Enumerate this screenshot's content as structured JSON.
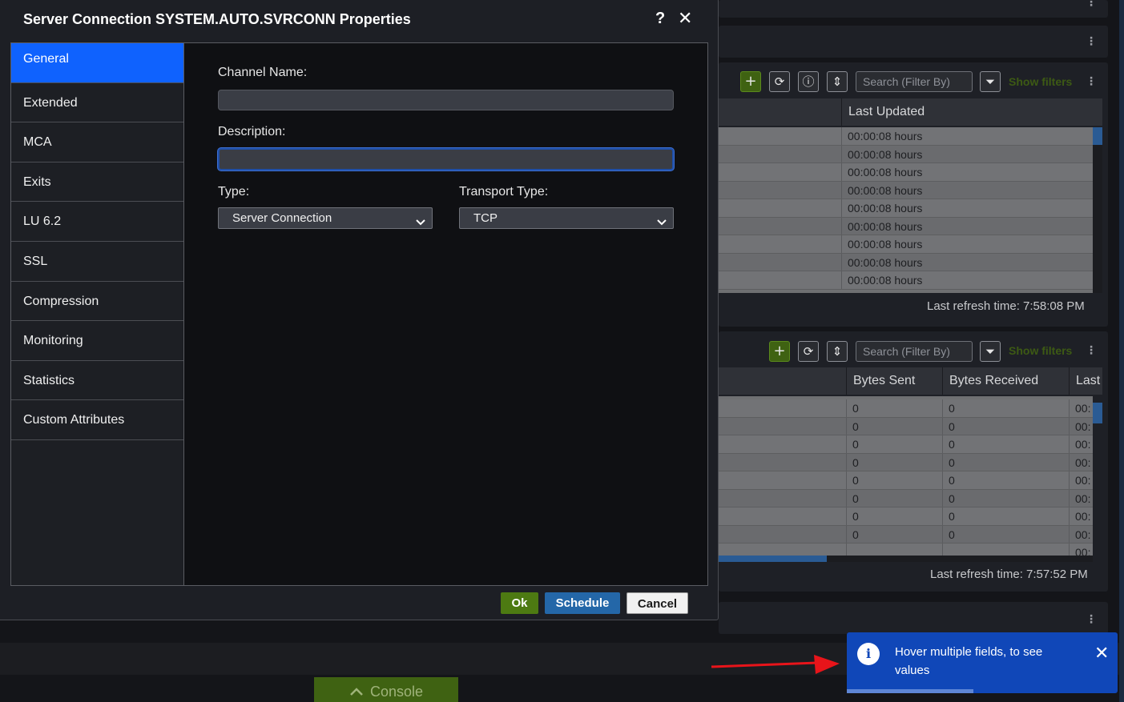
{
  "dialog": {
    "title": "Server Connection SYSTEM.AUTO.SVRCONN Properties",
    "help_icon": "?",
    "close_icon": "✕",
    "sidebar": {
      "items": [
        {
          "label": "General",
          "active": true
        },
        {
          "label": "Extended"
        },
        {
          "label": "MCA"
        },
        {
          "label": "Exits"
        },
        {
          "label": "LU 6.2"
        },
        {
          "label": "SSL"
        },
        {
          "label": "Compression"
        },
        {
          "label": "Monitoring"
        },
        {
          "label": "Statistics"
        },
        {
          "label": "Custom Attributes"
        }
      ]
    },
    "form": {
      "channel_name_label": "Channel Name:",
      "channel_name_value": "",
      "description_label": "Description:",
      "description_value": "",
      "type_label": "Type:",
      "type_value": "Server Connection",
      "transport_label": "Transport Type:",
      "transport_value": "TCP"
    },
    "buttons": {
      "ok": "Ok",
      "schedule": "Schedule",
      "cancel": "Cancel"
    }
  },
  "background": {
    "widget1": {
      "search_placeholder": "Search (Filter By)",
      "show_filters": "Show filters",
      "columns": [
        "Last Updated"
      ],
      "rows": [
        "00:00:08 hours",
        "00:00:08 hours",
        "00:00:08 hours",
        "00:00:08 hours",
        "00:00:08 hours",
        "00:00:08 hours",
        "00:00:08 hours",
        "00:00:08 hours",
        "00:00:08 hours"
      ],
      "refresh_text": "Last refresh time: 7:58:08 PM"
    },
    "widget2": {
      "search_placeholder": "Search (Filter By)",
      "show_filters": "Show filters",
      "columns": [
        "Bytes Sent",
        "Bytes Received",
        "Last"
      ],
      "rows": [
        [
          "0",
          "0",
          "00:"
        ],
        [
          "0",
          "0",
          "00:"
        ],
        [
          "0",
          "0",
          "00:"
        ],
        [
          "0",
          "0",
          "00:"
        ],
        [
          "0",
          "0",
          "00:"
        ],
        [
          "0",
          "0",
          "00:"
        ],
        [
          "0",
          "0",
          "00:"
        ],
        [
          "0",
          "0",
          "00:"
        ],
        [
          "",
          "",
          "00:"
        ]
      ],
      "refresh_text": "Last refresh time: 7:57:52 PM"
    },
    "console_label": "Console"
  },
  "toast": {
    "message": "Hover multiple fields, to see values",
    "icon": "i",
    "close_icon": "✕"
  },
  "colors": {
    "accent_blue": "#0f62fe",
    "ok_green": "#4d7a12",
    "schedule_blue": "#2467a8",
    "toast_blue": "#1047b8",
    "arrow_red": "#e8141a"
  }
}
